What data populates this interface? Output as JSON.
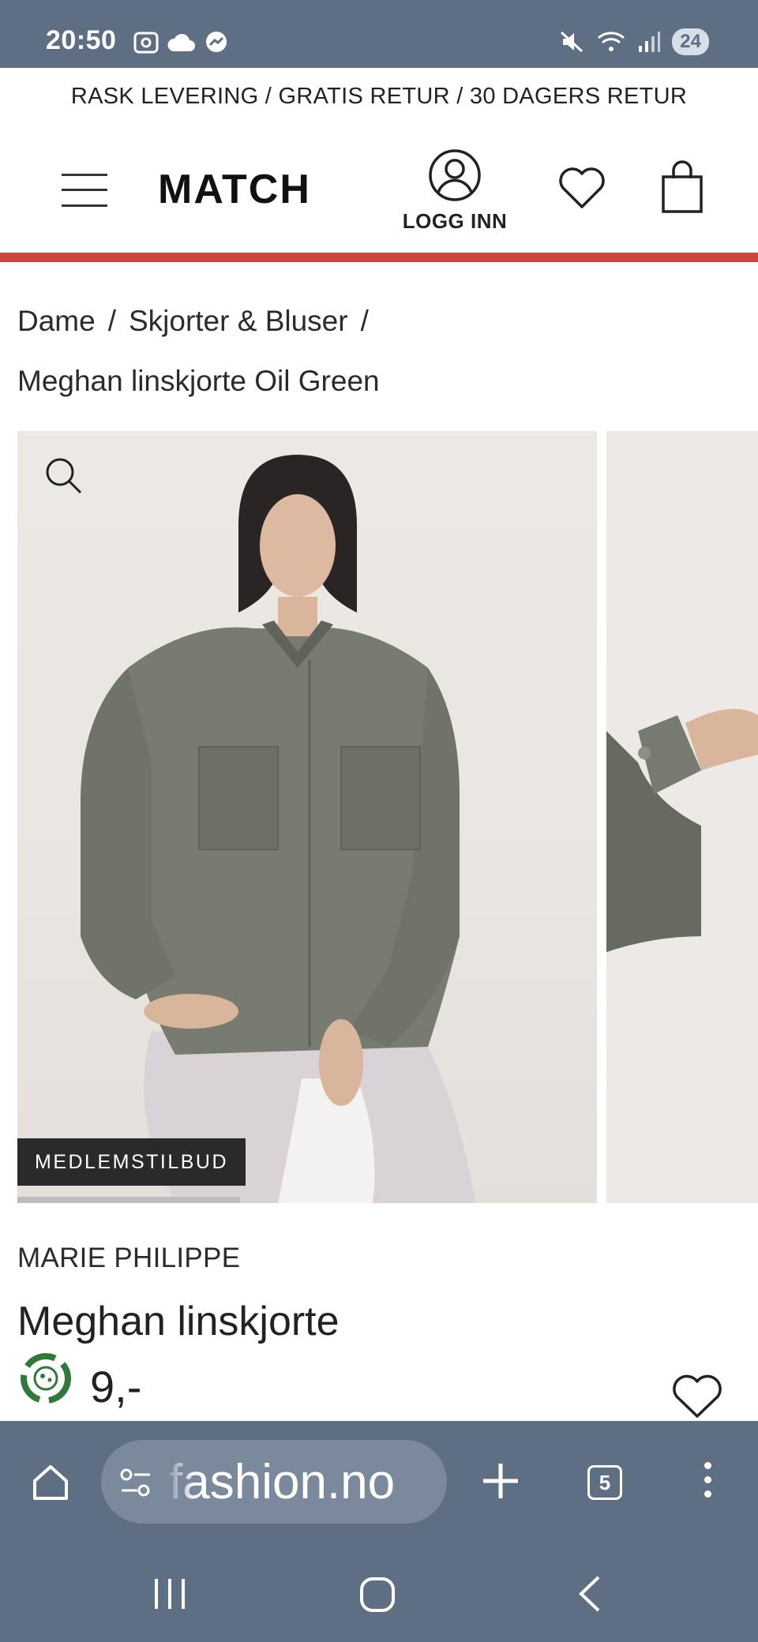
{
  "status_bar": {
    "time": "20:50",
    "battery": "24",
    "icons_left": [
      "screenshot-icon",
      "cloud-icon",
      "messenger-icon"
    ],
    "icons_right": [
      "mute-icon",
      "wifi-icon",
      "signal-icon",
      "battery-icon"
    ]
  },
  "promo": {
    "text": "RASK LEVERING / GRATIS RETUR / 30 DAGERS RETUR"
  },
  "header": {
    "logo": "MATCH",
    "login_label": "LOGG INN",
    "accent_color": "#c9473f"
  },
  "breadcrumb": {
    "items": [
      "Dame",
      "Skjorter & Bluser"
    ],
    "separator": "/",
    "current": "Meghan linskjorte Oil Green"
  },
  "gallery": {
    "badge": "MEDLEMSTILBUD",
    "image_count_visible": 2
  },
  "product": {
    "brand": "MARIE PHILIPPE",
    "title": "Meghan linskjorte",
    "price": "9,-"
  },
  "browser": {
    "url": "fashion.no",
    "tab_count": "5"
  },
  "colors": {
    "system_bar": "#5e6f83",
    "url_box": "#7a8a9c",
    "badge_bg": "#2a2a2a"
  }
}
